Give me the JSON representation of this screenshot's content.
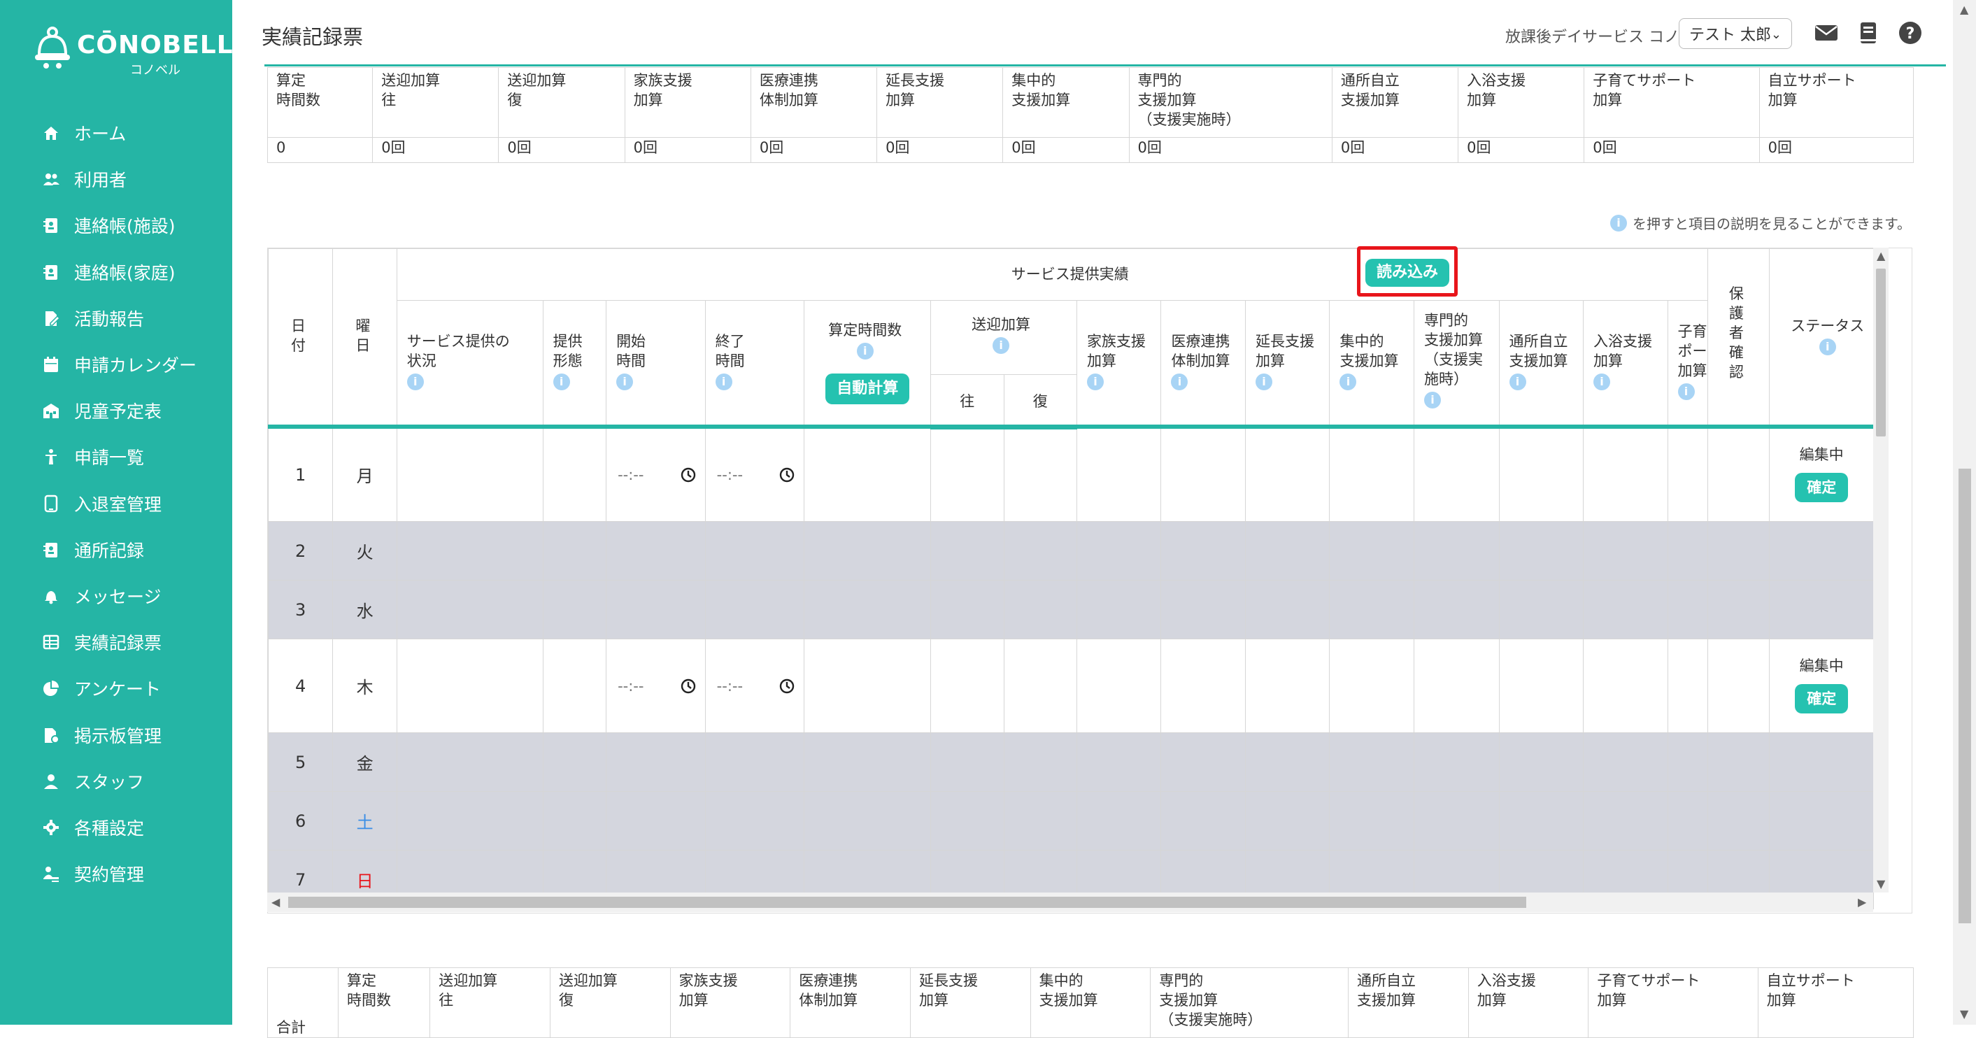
{
  "app": {
    "name": "CŌNOBELL",
    "sub": "コノベル"
  },
  "nav": [
    {
      "label": "ホーム",
      "icon": "home-icon"
    },
    {
      "label": "利用者",
      "icon": "users-icon"
    },
    {
      "label": "連絡帳(施設)",
      "icon": "contact-book-icon"
    },
    {
      "label": "連絡帳(家庭)",
      "icon": "contact-book-icon"
    },
    {
      "label": "活動報告",
      "icon": "report-icon"
    },
    {
      "label": "申請カレンダー",
      "icon": "calendar-icon"
    },
    {
      "label": "児童予定表",
      "icon": "schedule-icon"
    },
    {
      "label": "申請一覧",
      "icon": "request-list-icon"
    },
    {
      "label": "入退室管理",
      "icon": "tablet-icon"
    },
    {
      "label": "通所記録",
      "icon": "record-icon"
    },
    {
      "label": "メッセージ",
      "icon": "bell-icon"
    },
    {
      "label": "実績記録票",
      "icon": "table-icon"
    },
    {
      "label": "アンケート",
      "icon": "pie-chart-icon"
    },
    {
      "label": "掲示板管理",
      "icon": "board-icon"
    },
    {
      "label": "スタッフ",
      "icon": "staff-icon"
    },
    {
      "label": "各種設定",
      "icon": "gear-icon"
    },
    {
      "label": "契約管理",
      "icon": "contract-icon"
    }
  ],
  "header": {
    "title": "実績記録票",
    "facility": "放課後デイサービス コノベル",
    "user": "テスト 太郎"
  },
  "summary_top": {
    "headers": [
      "算定\n時間数",
      "送迎加算\n往",
      "送迎加算\n復",
      "家族支援\n加算",
      "医療連携\n体制加算",
      "延長支援\n加算",
      "集中的\n支援加算",
      "専門的\n支援加算\n（支援実施時）",
      "通所自立\n支援加算",
      "入浴支援\n加算",
      "子育てサポート\n加算",
      "自立サポート\n加算"
    ],
    "values": [
      "0",
      "0回",
      "0回",
      "0回",
      "0回",
      "0回",
      "0回",
      "0回",
      "0回",
      "0回",
      "0回",
      "0回"
    ]
  },
  "hint": "を押すと項目の説明を見ることができます。",
  "grid": {
    "col_date": "日\n付",
    "col_dow": "曜\n日",
    "service_group": "サービス提供実績",
    "read_button": "読み込み",
    "col_status_provided": "サービス提供の\n状況",
    "col_form": "提供\n形態",
    "col_start": "開始\n時間",
    "col_end": "終了\n時間",
    "col_hours": "算定時間数",
    "auto_calc": "自動計算",
    "col_transport": "送迎加算",
    "col_transport_out": "往",
    "col_transport_back": "復",
    "col_family": "家族支援\n加算",
    "col_medical": "医療連携\n体制加算",
    "col_extend": "延長支援\n加算",
    "col_intensive": "集中的\n支援加算",
    "col_specialist": "専門的\n支援加算\n（支援実\n施時）",
    "col_independent": "通所自立\n支援加算",
    "col_bath": "入浴支援\n加算",
    "col_parenting": "子育\nポー\n加算",
    "col_guardian": "保\n護\n者\n確\n認",
    "col_status": "ステータス",
    "time_placeholder": "--:--",
    "rows": [
      {
        "day": "1",
        "dow": "月",
        "editable": true,
        "status": "編集中",
        "confirm": "確定"
      },
      {
        "day": "2",
        "dow": "火",
        "editable": false
      },
      {
        "day": "3",
        "dow": "水",
        "editable": false
      },
      {
        "day": "4",
        "dow": "木",
        "editable": true,
        "status": "編集中",
        "confirm": "確定"
      },
      {
        "day": "5",
        "dow": "金",
        "editable": false
      },
      {
        "day": "6",
        "dow": "土",
        "editable": false,
        "dow_color": "#3a8ee6"
      },
      {
        "day": "7",
        "dow": "日",
        "editable": false,
        "dow_color": "#e8151b"
      }
    ]
  },
  "summary_bottom": {
    "total_label": "合計",
    "headers": [
      "算定\n時間数",
      "送迎加算\n往",
      "送迎加算\n復",
      "家族支援\n加算",
      "医療連携\n体制加算",
      "延長支援\n加算",
      "集中的\n支援加算",
      "専門的\n支援加算\n（支援実施時）",
      "通所自立\n支援加算",
      "入浴支援\n加算",
      "子育てサポート\n加算",
      "自立サポート\n加算"
    ]
  },
  "colors": {
    "accent": "#25B5A5",
    "button": "#25C2B0",
    "highlight": "#e8151b",
    "disabled_row": "#d4d6de"
  }
}
